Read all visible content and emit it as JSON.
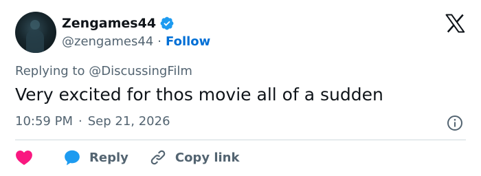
{
  "author": {
    "display_name": "Zengames44",
    "handle": "@zengames44",
    "separator": "·",
    "follow_label": "Follow"
  },
  "reply_context": {
    "prefix": "Replying to",
    "mention": "@DiscussingFilm"
  },
  "tweet": {
    "text": "Very excited for thos movie all of a sudden",
    "time": "10:59 PM",
    "separator": "·",
    "date": "Sep 21, 2026"
  },
  "actions": {
    "reply_label": "Reply",
    "copy_link_label": "Copy link"
  },
  "icons": {
    "verified": "verified-badge-icon",
    "logo": "x-logo-icon",
    "info": "info-icon",
    "like": "heart-icon",
    "reply": "speech-bubble-icon",
    "copy_link": "link-icon"
  },
  "colors": {
    "verified": "#1d9bf0",
    "follow": "#006fd6",
    "like": "#f91880",
    "reply": "#1d9bf0",
    "muted_text": "#536471",
    "text": "#0f1419",
    "divider": "#cfd9de"
  }
}
